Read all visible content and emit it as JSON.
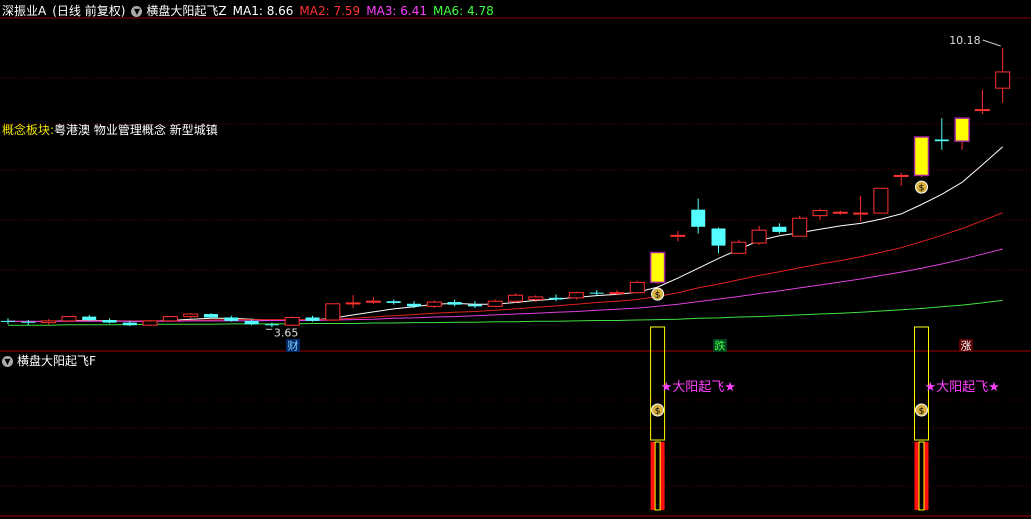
{
  "header": {
    "name": "深振业A",
    "mode": "(日线 前复权)",
    "indicator": "横盘大阳起飞Z",
    "ma": [
      {
        "label": "MA1: 8.66",
        "color": "#ffffff"
      },
      {
        "label": "MA2: 7.59",
        "color": "#ff3030"
      },
      {
        "label": "MA3: 6.41",
        "color": "#ff40ff"
      },
      {
        "label": "MA6: 4.78",
        "color": "#40ff40"
      }
    ]
  },
  "concept": {
    "key": "概念板块:",
    "value": "粤港澳 物业管理概念 新型城镇"
  },
  "sub_header": {
    "indicator": "横盘大阳起飞F"
  },
  "markers": {
    "high": "10.18",
    "low": "3.65",
    "cai": "财",
    "die": "跌",
    "zhang": "涨",
    "signal": "★大阳起飞★"
  },
  "colors": {
    "up": "#ff3030",
    "down": "#54ffff",
    "signal": "#ffff00",
    "ma1": "#ffffff",
    "ma2": "#e02020",
    "ma3": "#e040e0",
    "ma6": "#40e040",
    "grid": "#5a0000"
  },
  "chart_data": {
    "type": "candlestick",
    "price_range": [
      3.4,
      10.6
    ],
    "ohlc": [
      [
        3.8,
        3.86,
        3.72,
        3.78
      ],
      [
        3.78,
        3.82,
        3.7,
        3.76
      ],
      [
        3.76,
        3.84,
        3.72,
        3.8
      ],
      [
        3.8,
        3.92,
        3.78,
        3.9
      ],
      [
        3.9,
        3.94,
        3.8,
        3.82
      ],
      [
        3.82,
        3.86,
        3.74,
        3.76
      ],
      [
        3.76,
        3.8,
        3.68,
        3.7
      ],
      [
        3.7,
        3.82,
        3.68,
        3.8
      ],
      [
        3.8,
        3.92,
        3.78,
        3.9
      ],
      [
        3.9,
        3.98,
        3.86,
        3.96
      ],
      [
        3.96,
        3.98,
        3.86,
        3.88
      ],
      [
        3.88,
        3.92,
        3.78,
        3.8
      ],
      [
        3.8,
        3.84,
        3.7,
        3.72
      ],
      [
        3.72,
        3.76,
        3.65,
        3.7
      ],
      [
        3.7,
        3.9,
        3.68,
        3.88
      ],
      [
        3.88,
        3.92,
        3.78,
        3.8
      ],
      [
        3.82,
        4.2,
        3.8,
        4.2
      ],
      [
        4.2,
        4.4,
        4.1,
        4.22
      ],
      [
        4.24,
        4.36,
        4.2,
        4.26
      ],
      [
        4.26,
        4.3,
        4.18,
        4.22
      ],
      [
        4.2,
        4.26,
        4.1,
        4.14
      ],
      [
        4.14,
        4.28,
        4.1,
        4.24
      ],
      [
        4.24,
        4.3,
        4.14,
        4.18
      ],
      [
        4.18,
        4.26,
        4.1,
        4.14
      ],
      [
        4.14,
        4.3,
        4.12,
        4.26
      ],
      [
        4.26,
        4.44,
        4.22,
        4.4
      ],
      [
        4.3,
        4.4,
        4.24,
        4.36
      ],
      [
        4.34,
        4.42,
        4.26,
        4.3
      ],
      [
        4.34,
        4.48,
        4.3,
        4.46
      ],
      [
        4.46,
        4.52,
        4.4,
        4.44
      ],
      [
        4.44,
        4.52,
        4.4,
        4.46
      ],
      [
        4.46,
        4.74,
        4.44,
        4.7
      ],
      [
        4.7,
        5.4,
        4.66,
        5.4
      ],
      [
        5.8,
        5.9,
        5.66,
        5.8
      ],
      [
        6.4,
        6.66,
        5.84,
        6.0
      ],
      [
        5.96,
        5.98,
        5.38,
        5.56
      ],
      [
        5.38,
        5.7,
        5.36,
        5.64
      ],
      [
        5.62,
        6.02,
        5.58,
        5.92
      ],
      [
        6.0,
        6.08,
        5.84,
        5.88
      ],
      [
        5.78,
        6.26,
        5.78,
        6.2
      ],
      [
        6.26,
        6.42,
        6.16,
        6.38
      ],
      [
        6.32,
        6.38,
        6.28,
        6.34
      ],
      [
        6.32,
        6.72,
        6.12,
        6.32
      ],
      [
        6.32,
        6.9,
        6.32,
        6.9
      ],
      [
        7.2,
        7.26,
        6.96,
        7.2
      ],
      [
        7.2,
        8.1,
        7.16,
        8.1
      ],
      [
        8.04,
        8.54,
        7.8,
        8.0
      ],
      [
        8.0,
        8.54,
        7.8,
        8.54
      ],
      [
        8.74,
        9.2,
        8.64,
        8.74
      ],
      [
        9.24,
        10.18,
        8.9,
        9.62
      ]
    ],
    "signal_indices": [
      32,
      45,
      47
    ],
    "signal_bars": [
      {
        "index": 32,
        "value": 1
      },
      {
        "index": 45,
        "value": 1
      }
    ],
    "sub_range": [
      0,
      1
    ],
    "ma_series": [
      {
        "name": "MA1",
        "values": [
          3.79,
          3.78,
          3.79,
          3.81,
          3.81,
          3.81,
          3.79,
          3.79,
          3.81,
          3.84,
          3.86,
          3.86,
          3.84,
          3.81,
          3.81,
          3.82,
          3.86,
          3.94,
          4.01,
          4.08,
          4.13,
          4.19,
          4.21,
          4.19,
          4.19,
          4.23,
          4.28,
          4.31,
          4.35,
          4.39,
          4.42,
          4.47,
          4.59,
          4.8,
          5.03,
          5.26,
          5.47,
          5.68,
          5.79,
          5.86,
          5.94,
          6.02,
          6.08,
          6.18,
          6.3,
          6.52,
          6.76,
          7.04,
          7.45,
          7.87
        ]
      },
      {
        "name": "MA2",
        "values": [
          3.79,
          3.78,
          3.79,
          3.8,
          3.8,
          3.8,
          3.8,
          3.8,
          3.8,
          3.81,
          3.82,
          3.83,
          3.83,
          3.83,
          3.83,
          3.83,
          3.84,
          3.86,
          3.89,
          3.92,
          3.95,
          3.98,
          4.0,
          4.02,
          4.05,
          4.08,
          4.12,
          4.15,
          4.19,
          4.23,
          4.26,
          4.3,
          4.37,
          4.46,
          4.57,
          4.66,
          4.76,
          4.86,
          4.95,
          5.04,
          5.13,
          5.21,
          5.3,
          5.4,
          5.51,
          5.65,
          5.8,
          5.96,
          6.14,
          6.33
        ]
      },
      {
        "name": "MA3",
        "values": [
          3.79,
          3.79,
          3.79,
          3.79,
          3.79,
          3.79,
          3.79,
          3.79,
          3.79,
          3.8,
          3.8,
          3.8,
          3.8,
          3.81,
          3.81,
          3.81,
          3.82,
          3.83,
          3.84,
          3.86,
          3.87,
          3.89,
          3.9,
          3.92,
          3.94,
          3.96,
          3.98,
          4.0,
          4.02,
          4.05,
          4.07,
          4.1,
          4.14,
          4.19,
          4.25,
          4.31,
          4.37,
          4.44,
          4.5,
          4.57,
          4.64,
          4.71,
          4.78,
          4.86,
          4.94,
          5.03,
          5.13,
          5.24,
          5.36,
          5.48
        ]
      },
      {
        "name": "MA6",
        "values": [
          3.7,
          3.7,
          3.7,
          3.71,
          3.71,
          3.71,
          3.71,
          3.72,
          3.72,
          3.72,
          3.72,
          3.73,
          3.73,
          3.73,
          3.73,
          3.74,
          3.74,
          3.74,
          3.75,
          3.75,
          3.76,
          3.76,
          3.77,
          3.77,
          3.78,
          3.78,
          3.79,
          3.79,
          3.8,
          3.81,
          3.81,
          3.82,
          3.83,
          3.84,
          3.86,
          3.87,
          3.89,
          3.9,
          3.92,
          3.94,
          3.96,
          3.98,
          4.0,
          4.03,
          4.06,
          4.09,
          4.13,
          4.17,
          4.22,
          4.28
        ]
      }
    ]
  }
}
